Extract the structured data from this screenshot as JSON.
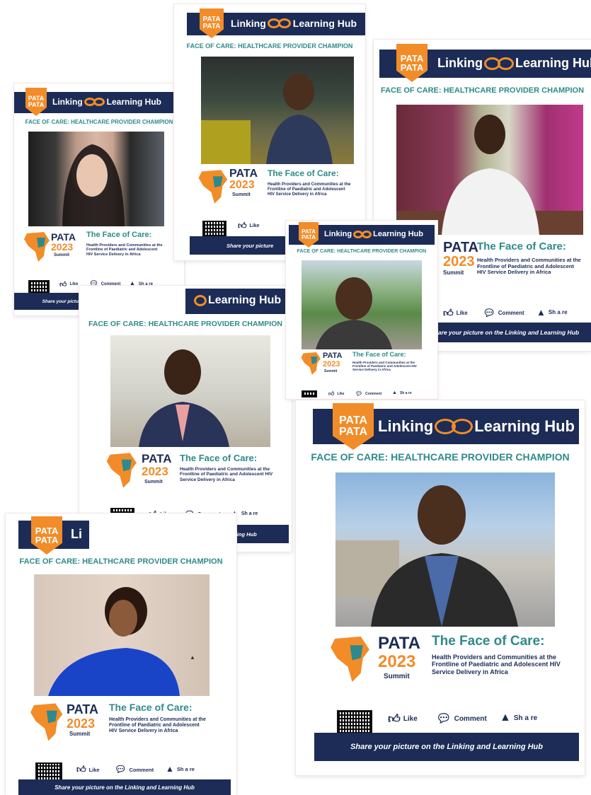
{
  "hub": {
    "logo_line1": "PATA",
    "logo_line2": "PATA",
    "linking": "Linking",
    "learning_hub": "Learning Hub",
    "learning_hub_partial": "Learning Hub",
    "linking_partial": "Li"
  },
  "heading": "FACE OF CARE: HEALTHCARE PROVIDER CHAMPION",
  "summit": {
    "pata": "PATA",
    "year": "2023",
    "summit": "Summit"
  },
  "face_of_care": {
    "title": "The Face of Care:",
    "subtitle": "Health Providers and Communities at the Frontline of Paediatric and Adolescent HIV Service Delivery in Africa"
  },
  "social": {
    "like": "Like",
    "comment": "Comment",
    "share": "Sh a re"
  },
  "footer": "Share your picture on the Linking and Learning Hub",
  "footer_partial": "Share your picture",
  "colors": {
    "navy": "#1c2c56",
    "orange": "#f28c28",
    "teal": "#2e8a8a",
    "red": "#d8232a"
  }
}
